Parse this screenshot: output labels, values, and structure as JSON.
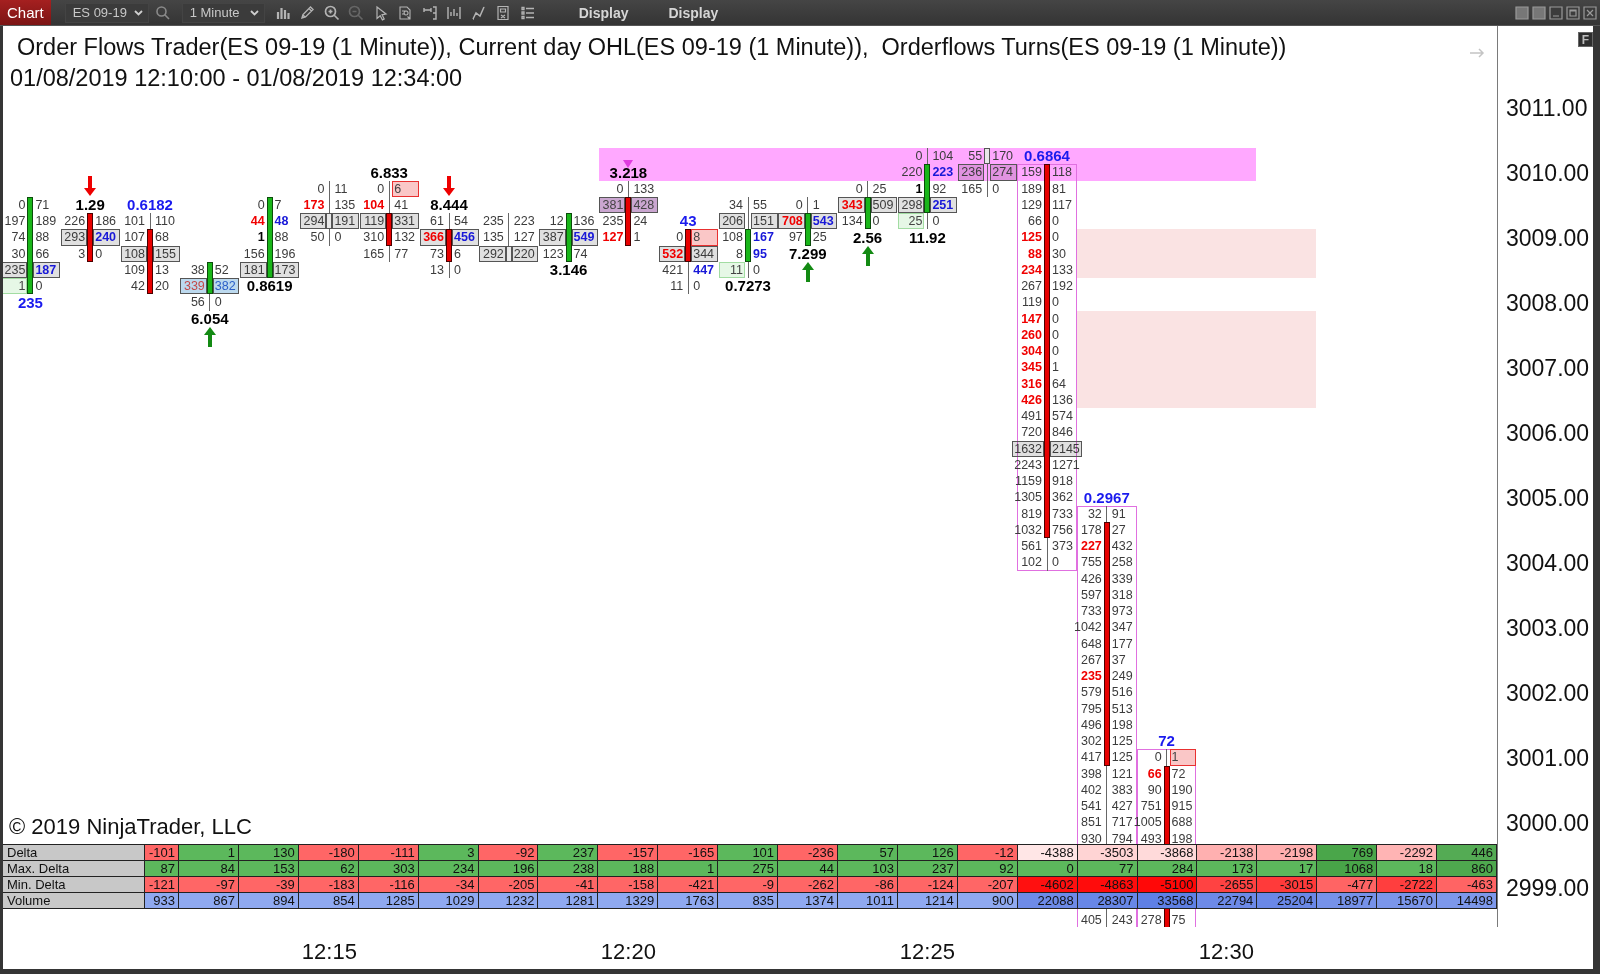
{
  "toolbar": {
    "tabs": [
      {
        "label": "Chart",
        "selected": true
      }
    ],
    "instrument": "ES 09-19",
    "interval": "1 Minute",
    "menus": [
      "Display",
      "Display"
    ]
  },
  "chart": {
    "title": "Order Flows Trader(ES 09-19 (1 Minute)), Current day OHL(ES 09-19 (1 Minute)),  Orderflows Turns(ES 09-19 (1 Minute))",
    "range": "01/08/2019 12:10:00 - 01/08/2019 12:34:00",
    "bars": [
      {
        "kind": "up",
        "outlined": false,
        "ohl_marker": false,
        "label": {
          "text": "235",
          "color": "#1a1aee"
        },
        "body_rows": [
          {
            "bid": {
              "text": "0",
              "kind": "plain"
            },
            "ask": {
              "text": "71",
              "kind": "plain"
            }
          },
          {
            "bid": {
              "text": "197",
              "kind": "plain"
            },
            "ask": {
              "text": "189",
              "kind": "plain"
            }
          },
          {
            "bid": {
              "text": "74",
              "kind": "plain"
            },
            "ask": {
              "text": "88",
              "kind": "plain"
            }
          },
          {
            "bid": {
              "text": "30",
              "kind": "plain"
            },
            "ask": {
              "text": "66",
              "kind": "plain"
            }
          },
          {
            "bid": {
              "text": "235",
              "kind": "poc"
            },
            "ask": {
              "text": "187",
              "kind": "pocbuy"
            }
          },
          {
            "bid": {
              "text": "1",
              "kind": "greenbox"
            },
            "ask": {
              "text": "0",
              "kind": "plain"
            }
          }
        ]
      },
      {
        "kind": "down",
        "outlined": false,
        "ohl_marker": false,
        "arrow": {
          "kind": "down"
        },
        "label": {
          "text": "1.29",
          "color": "#000000"
        },
        "body_rows": [
          {
            "bid": {
              "text": "226",
              "kind": "plain"
            },
            "ask": {
              "text": "186",
              "kind": "plain"
            }
          },
          {
            "bid": {
              "text": "293",
              "kind": "poc"
            },
            "ask": {
              "text": "240",
              "kind": "pocbuy"
            }
          },
          {
            "bid": {
              "text": "3",
              "kind": "plain"
            },
            "ask": {
              "text": "0",
              "kind": "plain"
            }
          }
        ]
      },
      {
        "kind": "down",
        "outlined": false,
        "ohl_marker": false,
        "label": {
          "text": "0.6182",
          "color": "#1a1aee"
        },
        "upper_rows": [
          {
            "bid": {
              "text": "101",
              "kind": "plain"
            },
            "ask": {
              "text": "110",
              "kind": "plain"
            }
          }
        ],
        "body_rows": [
          {
            "bid": {
              "text": "107",
              "kind": "plain"
            },
            "ask": {
              "text": "68",
              "kind": "plain"
            }
          },
          {
            "bid": {
              "text": "108",
              "kind": "poc"
            },
            "ask": {
              "text": "155",
              "kind": "poc"
            }
          },
          {
            "bid": {
              "text": "109",
              "kind": "plain"
            },
            "ask": {
              "text": "13",
              "kind": "plain"
            }
          },
          {
            "bid": {
              "text": "42",
              "kind": "plain"
            },
            "ask": {
              "text": "20",
              "kind": "plain"
            }
          }
        ]
      },
      {
        "kind": "up",
        "outlined": false,
        "ohl_marker": false,
        "arrow": {
          "kind": "up"
        },
        "label": {
          "text": "6.054",
          "color": "#000000"
        },
        "body_rows": [
          {
            "bid": {
              "text": "38",
              "kind": "plain"
            },
            "ask": {
              "text": "52",
              "kind": "plain"
            }
          },
          {
            "bid": {
              "text": "339",
              "kind": "bluesell"
            },
            "ask": {
              "text": "382",
              "kind": "bluebuy"
            }
          }
        ],
        "lower_rows": [
          {
            "bid": {
              "text": "56",
              "kind": "plain"
            },
            "ask": {
              "text": "0",
              "kind": "plain"
            }
          }
        ]
      },
      {
        "kind": "up",
        "outlined": false,
        "ohl_marker": false,
        "label": {
          "text": "0.8619",
          "color": "#000000"
        },
        "body_rows": [
          {
            "bid": {
              "text": "0",
              "kind": "plain"
            },
            "ask": {
              "text": "7",
              "kind": "plain"
            }
          },
          {
            "bid": {
              "text": "44",
              "kind": "sell"
            },
            "ask": {
              "text": "48",
              "kind": "buy"
            }
          },
          {
            "bid": {
              "text": "1",
              "kind": "bold"
            },
            "ask": {
              "text": "88",
              "kind": "plain"
            }
          },
          {
            "bid": {
              "text": "156",
              "kind": "plain"
            },
            "ask": {
              "text": "196",
              "kind": "plain"
            }
          },
          {
            "bid": {
              "text": "181",
              "kind": "poc"
            },
            "ask": {
              "text": "173",
              "kind": "poc"
            }
          }
        ]
      },
      {
        "kind": "flat",
        "outlined": false,
        "ohl_marker": false,
        "upper_rows": [
          {
            "bid": {
              "text": "0",
              "kind": "plain"
            },
            "ask": {
              "text": "11",
              "kind": "plain"
            }
          },
          {
            "bid": {
              "text": "173",
              "kind": "sell"
            },
            "ask": {
              "text": "135",
              "kind": "plain"
            }
          }
        ],
        "body_rows": [
          {
            "bid": {
              "text": "294",
              "kind": "poc"
            },
            "ask": {
              "text": "191",
              "kind": "poc"
            }
          }
        ],
        "lower_rows": [
          {
            "bid": {
              "text": "50",
              "kind": "plain"
            },
            "ask": {
              "text": "0",
              "kind": "plain"
            }
          }
        ]
      },
      {
        "kind": "down",
        "outlined": false,
        "ohl_marker": false,
        "label": {
          "text": "6.833",
          "color": "#000000"
        },
        "upper_rows": [
          {
            "bid": {
              "text": "0",
              "kind": "plain"
            },
            "ask": {
              "text": "6",
              "kind": "redbox"
            }
          },
          {
            "bid": {
              "text": "104",
              "kind": "sell"
            },
            "ask": {
              "text": "41",
              "kind": "plain"
            }
          }
        ],
        "body_rows": [
          {
            "bid": {
              "text": "119",
              "kind": "poc"
            },
            "ask": {
              "text": "331",
              "kind": "poc"
            }
          },
          {
            "bid": {
              "text": "310",
              "kind": "plain"
            },
            "ask": {
              "text": "132",
              "kind": "plain"
            }
          }
        ],
        "lower_rows": [
          {
            "bid": {
              "text": "165",
              "kind": "plain"
            },
            "ask": {
              "text": "77",
              "kind": "plain"
            }
          }
        ]
      },
      {
        "kind": "down",
        "outlined": false,
        "ohl_marker": false,
        "arrow": {
          "kind": "down"
        },
        "label": {
          "text": "8.444",
          "color": "#000000"
        },
        "upper_rows": [
          {
            "bid": {
              "text": "61",
              "kind": "plain"
            },
            "ask": {
              "text": "54",
              "kind": "plain"
            }
          }
        ],
        "body_rows": [
          {
            "bid": {
              "text": "366",
              "kind": "pocsell"
            },
            "ask": {
              "text": "456",
              "kind": "pocbuy"
            }
          },
          {
            "bid": {
              "text": "73",
              "kind": "plain"
            },
            "ask": {
              "text": "6",
              "kind": "plain"
            }
          }
        ],
        "lower_rows": [
          {
            "bid": {
              "text": "13",
              "kind": "plain"
            },
            "ask": {
              "text": "0",
              "kind": "plain"
            }
          }
        ]
      },
      {
        "kind": "flat",
        "outlined": false,
        "ohl_marker": false,
        "upper_rows": [
          {
            "bid": {
              "text": "235",
              "kind": "plain"
            },
            "ask": {
              "text": "223",
              "kind": "plain"
            }
          },
          {
            "bid": {
              "text": "135",
              "kind": "plain"
            },
            "ask": {
              "text": "127",
              "kind": "plain"
            }
          }
        ],
        "body_rows": [
          {
            "bid": {
              "text": "292",
              "kind": "poc"
            },
            "ask": {
              "text": "220",
              "kind": "poc"
            }
          }
        ]
      },
      {
        "kind": "up",
        "outlined": false,
        "ohl_marker": false,
        "label": {
          "text": "3.146",
          "color": "#000000"
        },
        "body_rows": [
          {
            "bid": {
              "text": "12",
              "kind": "plain"
            },
            "ask": {
              "text": "136",
              "kind": "plain"
            }
          },
          {
            "bid": {
              "text": "387",
              "kind": "poc"
            },
            "ask": {
              "text": "549",
              "kind": "pocbuy"
            }
          },
          {
            "bid": {
              "text": "123",
              "kind": "plain"
            },
            "ask": {
              "text": "74",
              "kind": "plain"
            }
          }
        ]
      },
      {
        "kind": "down",
        "outlined": false,
        "ohl_marker": true,
        "label": {
          "text": "3.218",
          "color": "#000000"
        },
        "upper_rows": [
          {
            "bid": {
              "text": "0",
              "kind": "plain"
            },
            "ask": {
              "text": "133",
              "kind": "plain"
            }
          }
        ],
        "body_rows": [
          {
            "bid": {
              "text": "381",
              "kind": "purplebox"
            },
            "ask": {
              "text": "428",
              "kind": "purplebox"
            }
          },
          {
            "bid": {
              "text": "235",
              "kind": "plain"
            },
            "ask": {
              "text": "24",
              "kind": "plain"
            }
          },
          {
            "bid": {
              "text": "127",
              "kind": "sell"
            },
            "ask": {
              "text": "1",
              "kind": "plain"
            }
          }
        ]
      },
      {
        "kind": "down",
        "outlined": false,
        "ohl_marker": false,
        "label": {
          "text": "43",
          "color": "#1a1aee"
        },
        "body_rows": [
          {
            "bid": {
              "text": "0",
              "kind": "plain"
            },
            "ask": {
              "text": "8",
              "kind": "redbox"
            }
          },
          {
            "bid": {
              "text": "532",
              "kind": "pocsell"
            },
            "ask": {
              "text": "344",
              "kind": "poc"
            }
          }
        ],
        "lower_rows": [
          {
            "bid": {
              "text": "421",
              "kind": "plain"
            },
            "ask": {
              "text": "447",
              "kind": "buy"
            }
          },
          {
            "bid": {
              "text": "11",
              "kind": "plain"
            },
            "ask": {
              "text": "0",
              "kind": "plain"
            }
          }
        ]
      },
      {
        "kind": "up",
        "outlined": false,
        "ohl_marker": false,
        "label": {
          "text": "0.7273",
          "color": "#000000"
        },
        "upper_rows": [
          {
            "bid": {
              "text": "34",
              "kind": "plain"
            },
            "ask": {
              "text": "55",
              "kind": "plain"
            }
          },
          {
            "bid": {
              "text": "206",
              "kind": "poc"
            },
            "ask": {
              "text": "151",
              "kind": "poc"
            }
          }
        ],
        "body_rows": [
          {
            "bid": {
              "text": "108",
              "kind": "plain"
            },
            "ask": {
              "text": "167",
              "kind": "buy"
            }
          },
          {
            "bid": {
              "text": "8",
              "kind": "plain"
            },
            "ask": {
              "text": "95",
              "kind": "buy"
            }
          }
        ],
        "lower_rows": [
          {
            "bid": {
              "text": "11",
              "kind": "greenbox"
            },
            "ask": {
              "text": "0",
              "kind": "plain"
            }
          }
        ]
      },
      {
        "kind": "up",
        "outlined": false,
        "ohl_marker": false,
        "arrow": {
          "kind": "up"
        },
        "label": {
          "text": "7.299",
          "color": "#000000"
        },
        "upper_rows": [
          {
            "bid": {
              "text": "0",
              "kind": "plain"
            },
            "ask": {
              "text": "1",
              "kind": "plain"
            }
          }
        ],
        "body_rows": [
          {
            "bid": {
              "text": "708",
              "kind": "pocsell"
            },
            "ask": {
              "text": "543",
              "kind": "pocbuy"
            }
          },
          {
            "bid": {
              "text": "97",
              "kind": "plain"
            },
            "ask": {
              "text": "25",
              "kind": "plain"
            }
          }
        ]
      },
      {
        "kind": "up",
        "outlined": false,
        "ohl_marker": false,
        "arrow": {
          "kind": "up"
        },
        "label": {
          "text": "2.56",
          "color": "#000000"
        },
        "upper_rows": [
          {
            "bid": {
              "text": "0",
              "kind": "plain"
            },
            "ask": {
              "text": "25",
              "kind": "plain"
            }
          }
        ],
        "body_rows": [
          {
            "bid": {
              "text": "343",
              "kind": "pocsell"
            },
            "ask": {
              "text": "509",
              "kind": "poc"
            }
          },
          {
            "bid": {
              "text": "134",
              "kind": "plain"
            },
            "ask": {
              "text": "0",
              "kind": "plain"
            }
          }
        ]
      },
      {
        "kind": "up",
        "outlined": false,
        "ohl_marker": false,
        "label": {
          "text": "11.92",
          "color": "#000000"
        },
        "upper_rows": [
          {
            "bid": {
              "text": "0",
              "kind": "plain"
            },
            "ask": {
              "text": "104",
              "kind": "plain"
            }
          }
        ],
        "body_rows": [
          {
            "bid": {
              "text": "220",
              "kind": "plain"
            },
            "ask": {
              "text": "223",
              "kind": "buy"
            }
          },
          {
            "bid": {
              "text": "1",
              "kind": "bold"
            },
            "ask": {
              "text": "92",
              "kind": "plain"
            }
          },
          {
            "bid": {
              "text": "298",
              "kind": "poc"
            },
            "ask": {
              "text": "251",
              "kind": "pocbuy"
            }
          }
        ],
        "lower_rows": [
          {
            "bid": {
              "text": "25",
              "kind": "greenbox"
            },
            "ask": {
              "text": "0",
              "kind": "plain"
            }
          }
        ]
      },
      {
        "kind": "flat",
        "outlined": false,
        "ohl_marker": false,
        "body_rows": [
          {
            "bid": {
              "text": "55",
              "kind": "plain"
            },
            "ask": {
              "text": "170",
              "kind": "plain"
            }
          }
        ],
        "lower_rows": [
          {
            "bid": {
              "text": "236",
              "kind": "poc"
            },
            "ask": {
              "text": "274",
              "kind": "poc"
            }
          },
          {
            "bid": {
              "text": "165",
              "kind": "plain"
            },
            "ask": {
              "text": "0",
              "kind": "plain"
            }
          }
        ]
      },
      {
        "kind": "down",
        "outlined": true,
        "ohl_marker": false,
        "label": {
          "text": "0.6864",
          "color": "#1a1aee"
        },
        "body_rows": [
          {
            "bid": {
              "text": "159",
              "kind": "plain"
            },
            "ask": {
              "text": "118",
              "kind": "plain"
            }
          },
          {
            "bid": {
              "text": "189",
              "kind": "plain"
            },
            "ask": {
              "text": "81",
              "kind": "plain"
            }
          },
          {
            "bid": {
              "text": "129",
              "kind": "plain"
            },
            "ask": {
              "text": "117",
              "kind": "plain"
            }
          },
          {
            "bid": {
              "text": "66",
              "kind": "plain"
            },
            "ask": {
              "text": "0",
              "kind": "plain"
            }
          },
          {
            "bid": {
              "text": "125",
              "kind": "sell"
            },
            "ask": {
              "text": "0",
              "kind": "plain"
            }
          },
          {
            "bid": {
              "text": "88",
              "kind": "sell"
            },
            "ask": {
              "text": "30",
              "kind": "plain"
            }
          },
          {
            "bid": {
              "text": "234",
              "kind": "sell"
            },
            "ask": {
              "text": "133",
              "kind": "plain"
            }
          },
          {
            "bid": {
              "text": "267",
              "kind": "plain"
            },
            "ask": {
              "text": "192",
              "kind": "plain"
            }
          },
          {
            "bid": {
              "text": "119",
              "kind": "plain"
            },
            "ask": {
              "text": "0",
              "kind": "plain"
            }
          },
          {
            "bid": {
              "text": "147",
              "kind": "sell"
            },
            "ask": {
              "text": "0",
              "kind": "plain"
            }
          },
          {
            "bid": {
              "text": "260",
              "kind": "sell"
            },
            "ask": {
              "text": "0",
              "kind": "plain"
            }
          },
          {
            "bid": {
              "text": "304",
              "kind": "sell"
            },
            "ask": {
              "text": "0",
              "kind": "plain"
            }
          },
          {
            "bid": {
              "text": "345",
              "kind": "sell"
            },
            "ask": {
              "text": "1",
              "kind": "plain"
            }
          },
          {
            "bid": {
              "text": "316",
              "kind": "sell"
            },
            "ask": {
              "text": "64",
              "kind": "plain"
            }
          },
          {
            "bid": {
              "text": "426",
              "kind": "sell"
            },
            "ask": {
              "text": "136",
              "kind": "plain"
            }
          },
          {
            "bid": {
              "text": "491",
              "kind": "plain"
            },
            "ask": {
              "text": "574",
              "kind": "plain"
            }
          },
          {
            "bid": {
              "text": "720",
              "kind": "plain"
            },
            "ask": {
              "text": "846",
              "kind": "plain"
            }
          },
          {
            "bid": {
              "text": "1632",
              "kind": "poc"
            },
            "ask": {
              "text": "2145",
              "kind": "poc"
            }
          },
          {
            "bid": {
              "text": "2243",
              "kind": "plain"
            },
            "ask": {
              "text": "1271",
              "kind": "plain"
            }
          },
          {
            "bid": {
              "text": "1159",
              "kind": "plain"
            },
            "ask": {
              "text": "918",
              "kind": "plain"
            }
          },
          {
            "bid": {
              "text": "1305",
              "kind": "plain"
            },
            "ask": {
              "text": "362",
              "kind": "plain"
            }
          },
          {
            "bid": {
              "text": "819",
              "kind": "plain"
            },
            "ask": {
              "text": "733",
              "kind": "plain"
            }
          },
          {
            "bid": {
              "text": "1032",
              "kind": "plain"
            },
            "ask": {
              "text": "756",
              "kind": "plain"
            }
          }
        ],
        "lower_rows": [
          {
            "bid": {
              "text": "561",
              "kind": "plain"
            },
            "ask": {
              "text": "373",
              "kind": "plain"
            }
          },
          {
            "bid": {
              "text": "102",
              "kind": "plain"
            },
            "ask": {
              "text": "0",
              "kind": "plain"
            }
          }
        ]
      },
      {
        "kind": "down",
        "outlined": true,
        "ohl_marker": false,
        "label": {
          "text": "0.2967",
          "color": "#1a1aee"
        },
        "upper_rows": [
          {
            "bid": {
              "text": "32",
              "kind": "plain"
            },
            "ask": {
              "text": "91",
              "kind": "plain"
            }
          }
        ],
        "body_rows": [
          {
            "bid": {
              "text": "178",
              "kind": "plain"
            },
            "ask": {
              "text": "27",
              "kind": "plain"
            }
          },
          {
            "bid": {
              "text": "227",
              "kind": "sell"
            },
            "ask": {
              "text": "432",
              "kind": "plain"
            }
          },
          {
            "bid": {
              "text": "755",
              "kind": "plain"
            },
            "ask": {
              "text": "258",
              "kind": "plain"
            }
          },
          {
            "bid": {
              "text": "426",
              "kind": "plain"
            },
            "ask": {
              "text": "339",
              "kind": "plain"
            }
          },
          {
            "bid": {
              "text": "597",
              "kind": "plain"
            },
            "ask": {
              "text": "318",
              "kind": "plain"
            }
          },
          {
            "bid": {
              "text": "733",
              "kind": "plain"
            },
            "ask": {
              "text": "973",
              "kind": "plain"
            }
          },
          {
            "bid": {
              "text": "1042",
              "kind": "plain"
            },
            "ask": {
              "text": "347",
              "kind": "plain"
            }
          },
          {
            "bid": {
              "text": "648",
              "kind": "plain"
            },
            "ask": {
              "text": "177",
              "kind": "plain"
            }
          },
          {
            "bid": {
              "text": "267",
              "kind": "plain"
            },
            "ask": {
              "text": "37",
              "kind": "plain"
            }
          },
          {
            "bid": {
              "text": "235",
              "kind": "sell"
            },
            "ask": {
              "text": "249",
              "kind": "plain"
            }
          },
          {
            "bid": {
              "text": "579",
              "kind": "plain"
            },
            "ask": {
              "text": "516",
              "kind": "plain"
            }
          },
          {
            "bid": {
              "text": "795",
              "kind": "plain"
            },
            "ask": {
              "text": "513",
              "kind": "plain"
            }
          },
          {
            "bid": {
              "text": "496",
              "kind": "plain"
            },
            "ask": {
              "text": "198",
              "kind": "plain"
            }
          },
          {
            "bid": {
              "text": "302",
              "kind": "plain"
            },
            "ask": {
              "text": "125",
              "kind": "plain"
            }
          },
          {
            "bid": {
              "text": "417",
              "kind": "plain"
            },
            "ask": {
              "text": "125",
              "kind": "plain"
            }
          }
        ],
        "lower_rows": [
          {
            "bid": {
              "text": "398",
              "kind": "plain"
            },
            "ask": {
              "text": "121",
              "kind": "plain"
            }
          },
          {
            "bid": {
              "text": "402",
              "kind": "plain"
            },
            "ask": {
              "text": "383",
              "kind": "plain"
            }
          },
          {
            "bid": {
              "text": "541",
              "kind": "plain"
            },
            "ask": {
              "text": "427",
              "kind": "plain"
            }
          },
          {
            "bid": {
              "text": "851",
              "kind": "plain"
            },
            "ask": {
              "text": "717",
              "kind": "plain"
            }
          },
          {
            "bid": {
              "text": "930",
              "kind": "plain"
            },
            "ask": {
              "text": "794",
              "kind": "plain"
            }
          },
          {
            "bid": {
              "text": "405",
              "kind": "plain"
            },
            "ask": {
              "text": "243",
              "kind": "plain"
            }
          }
        ]
      },
      {
        "kind": "down",
        "outlined": true,
        "ohl_marker": false,
        "label": {
          "text": "72",
          "color": "#1a1aee"
        },
        "upper_rows": [
          {
            "bid": {
              "text": "0",
              "kind": "plain"
            },
            "ask": {
              "text": "1",
              "kind": "redbox"
            }
          }
        ],
        "body_rows": [
          {
            "bid": {
              "text": "66",
              "kind": "sell"
            },
            "ask": {
              "text": "72",
              "kind": "plain"
            }
          },
          {
            "bid": {
              "text": "90",
              "kind": "plain"
            },
            "ask": {
              "text": "190",
              "kind": "plain"
            }
          },
          {
            "bid": {
              "text": "751",
              "kind": "plain"
            },
            "ask": {
              "text": "915",
              "kind": "plain"
            }
          },
          {
            "bid": {
              "text": "1005",
              "kind": "plain"
            },
            "ask": {
              "text": "688",
              "kind": "plain"
            }
          },
          {
            "bid": {
              "text": "493",
              "kind": "plain"
            },
            "ask": {
              "text": "198",
              "kind": "plain"
            }
          },
          {
            "bid": {
              "text": "278",
              "kind": "plain"
            },
            "ask": {
              "text": "75",
              "kind": "plain"
            }
          }
        ]
      }
    ],
    "copyright": "© 2019 NinjaTrader, LLC",
    "price_axis": {
      "button": "F",
      "labels": [
        "3011.00",
        "3010.00",
        "3009.00",
        "3008.00",
        "3007.00",
        "3006.00",
        "3005.00",
        "3004.00",
        "3003.00",
        "3002.00",
        "3001.00",
        "3000.00",
        "2999.00"
      ]
    },
    "time_labels": [
      "12:15",
      "12:20",
      "12:25",
      "12:30"
    ]
  },
  "table": {
    "rows": [
      {
        "label": "Delta",
        "cells": [
          {
            "text": "-101",
            "color": "#ff6666"
          },
          {
            "text": "1",
            "color": "#5cb85c"
          },
          {
            "text": "130",
            "color": "#5cb85c"
          },
          {
            "text": "-180",
            "color": "#ff6666"
          },
          {
            "text": "-111",
            "color": "#ff6666"
          },
          {
            "text": "3",
            "color": "#5cb85c"
          },
          {
            "text": "-92",
            "color": "#ff6666"
          },
          {
            "text": "237",
            "color": "#5cb85c"
          },
          {
            "text": "-157",
            "color": "#ff6666"
          },
          {
            "text": "-165",
            "color": "#ff6666"
          },
          {
            "text": "101",
            "color": "#5cb85c"
          },
          {
            "text": "-236",
            "color": "#ff6666"
          },
          {
            "text": "57",
            "color": "#5cb85c"
          },
          {
            "text": "126",
            "color": "#5cb85c"
          },
          {
            "text": "-12",
            "color": "#ff6666"
          },
          {
            "text": "-4388",
            "color": "#ffe6e6"
          },
          {
            "text": "-3503",
            "color": "#ffd4d4"
          },
          {
            "text": "-3868",
            "color": "#ffdada"
          },
          {
            "text": "-2138",
            "color": "#ffb0b0"
          },
          {
            "text": "-2198",
            "color": "#ffaeae"
          },
          {
            "text": "769",
            "color": "#4aa64a"
          },
          {
            "text": "-2292",
            "color": "#ffb4b4"
          },
          {
            "text": "446",
            "color": "#54ab54"
          }
        ]
      },
      {
        "label": "Max. Delta",
        "cells": [
          {
            "text": "87",
            "color": "#5cb85c"
          },
          {
            "text": "84",
            "color": "#5cb85c"
          },
          {
            "text": "153",
            "color": "#5cb85c"
          },
          {
            "text": "62",
            "color": "#5cb85c"
          },
          {
            "text": "303",
            "color": "#5cb85c"
          },
          {
            "text": "234",
            "color": "#5cb85c"
          },
          {
            "text": "196",
            "color": "#5cb85c"
          },
          {
            "text": "238",
            "color": "#5cb85c"
          },
          {
            "text": "188",
            "color": "#5cb85c"
          },
          {
            "text": "1",
            "color": "#5cb85c"
          },
          {
            "text": "275",
            "color": "#5cb85c"
          },
          {
            "text": "44",
            "color": "#5cb85c"
          },
          {
            "text": "103",
            "color": "#5cb85c"
          },
          {
            "text": "237",
            "color": "#5cb85c"
          },
          {
            "text": "92",
            "color": "#5cb85c"
          },
          {
            "text": "0",
            "color": "#5cb85c"
          },
          {
            "text": "77",
            "color": "#5cb85c"
          },
          {
            "text": "284",
            "color": "#5cb85c"
          },
          {
            "text": "173",
            "color": "#5cb85c"
          },
          {
            "text": "17",
            "color": "#5cb85c"
          },
          {
            "text": "1068",
            "color": "#48a448"
          },
          {
            "text": "18",
            "color": "#5cb85c"
          },
          {
            "text": "860",
            "color": "#4ea84e"
          }
        ]
      },
      {
        "label": "Min. Delta",
        "cells": [
          {
            "text": "-121",
            "color": "#ff6666"
          },
          {
            "text": "-97",
            "color": "#ff6666"
          },
          {
            "text": "-39",
            "color": "#ff6666"
          },
          {
            "text": "-183",
            "color": "#ff6666"
          },
          {
            "text": "-116",
            "color": "#ff6666"
          },
          {
            "text": "-34",
            "color": "#ff6666"
          },
          {
            "text": "-205",
            "color": "#ff6666"
          },
          {
            "text": "-41",
            "color": "#ff6666"
          },
          {
            "text": "-158",
            "color": "#ff6666"
          },
          {
            "text": "-421",
            "color": "#ff6666"
          },
          {
            "text": "-9",
            "color": "#ff6666"
          },
          {
            "text": "-262",
            "color": "#ff6666"
          },
          {
            "text": "-86",
            "color": "#ff6666"
          },
          {
            "text": "-124",
            "color": "#ff6666"
          },
          {
            "text": "-207",
            "color": "#ff6666"
          },
          {
            "text": "-4602",
            "color": "#ff1010"
          },
          {
            "text": "-4863",
            "color": "#ff0c0c"
          },
          {
            "text": "-5100",
            "color": "#ff0808"
          },
          {
            "text": "-2655",
            "color": "#ff4242"
          },
          {
            "text": "-3015",
            "color": "#ff3a3a"
          },
          {
            "text": "-477",
            "color": "#ff6464"
          },
          {
            "text": "-2722",
            "color": "#ff3e3e"
          },
          {
            "text": "-463",
            "color": "#ff6464"
          }
        ]
      },
      {
        "label": "Volume",
        "cells": [
          {
            "text": "933",
            "color": "#8fa9f0"
          },
          {
            "text": "867",
            "color": "#8fa9f0"
          },
          {
            "text": "894",
            "color": "#8fa9f0"
          },
          {
            "text": "854",
            "color": "#8fa9f0"
          },
          {
            "text": "1285",
            "color": "#8fa9f0"
          },
          {
            "text": "1029",
            "color": "#8fa9f0"
          },
          {
            "text": "1232",
            "color": "#8fa9f0"
          },
          {
            "text": "1281",
            "color": "#8fa9f0"
          },
          {
            "text": "1329",
            "color": "#8fa9f0"
          },
          {
            "text": "1763",
            "color": "#8fa9f0"
          },
          {
            "text": "835",
            "color": "#8fa9f0"
          },
          {
            "text": "1374",
            "color": "#8fa9f0"
          },
          {
            "text": "1011",
            "color": "#8fa9f0"
          },
          {
            "text": "1214",
            "color": "#8fa9f0"
          },
          {
            "text": "900",
            "color": "#8fa9f0"
          },
          {
            "text": "22088",
            "color": "#6e8be8"
          },
          {
            "text": "28307",
            "color": "#6887e7"
          },
          {
            "text": "33568",
            "color": "#5f80e5"
          },
          {
            "text": "22794",
            "color": "#6d8ae8"
          },
          {
            "text": "25204",
            "color": "#6a88e7"
          },
          {
            "text": "18977",
            "color": "#7692e9"
          },
          {
            "text": "15670",
            "color": "#7b96ea"
          },
          {
            "text": "14498",
            "color": "#7d98eb"
          }
        ]
      }
    ]
  }
}
